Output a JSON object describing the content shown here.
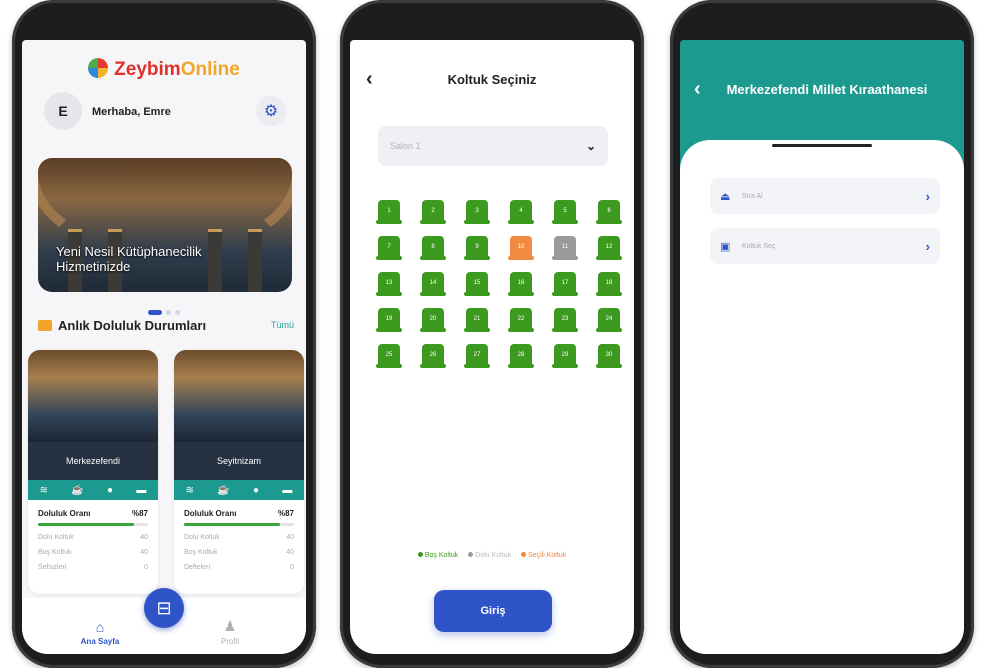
{
  "phone1": {
    "logo": {
      "part1": "Zeybim",
      "part2": "Online"
    },
    "avatar_letter": "E",
    "greeting": "Merhaba, Emre",
    "banner_text": "Yeni Nesil Kütüphanecilik Hizmetinizde",
    "section_title": "Anlık Doluluk Durumları",
    "section_link": "Tümü",
    "cards": [
      {
        "name": "Merkezefendi",
        "occupancy_label": "Doluluk Oranı",
        "occupancy": "%87",
        "occupancy_fraction": 0.87,
        "rows": [
          {
            "label": "Dolu Koltuk",
            "value": "40"
          },
          {
            "label": "Boş Koltuk",
            "value": "40"
          },
          {
            "label": "Sefsizleri",
            "value": "0"
          }
        ]
      },
      {
        "name": "Seyitnizam",
        "occupancy_label": "Doluluk Oranı",
        "occupancy": "%87",
        "occupancy_fraction": 0.87,
        "rows": [
          {
            "label": "Dolu Koltuk",
            "value": "40"
          },
          {
            "label": "Boş Koltuk",
            "value": "40"
          },
          {
            "label": "Defteleri",
            "value": "0"
          }
        ]
      }
    ],
    "tabs": {
      "home": "Ana Sayfa",
      "profile": "Profil"
    }
  },
  "phone2": {
    "title": "Koltuk Seçiniz",
    "select_placeholder": "Salon 1",
    "seats": [
      "1",
      "2",
      "3",
      "4",
      "5",
      "6",
      "7",
      "8",
      "9",
      "10",
      "11",
      "12",
      "13",
      "14",
      "15",
      "16",
      "17",
      "18",
      "19",
      "20",
      "21",
      "22",
      "23",
      "24",
      "25",
      "26",
      "27",
      "28",
      "29",
      "30"
    ],
    "selected_seat": "10",
    "full_seat": "11",
    "legend": {
      "empty": "Boş Koltuk",
      "full": "Dolu Koltuk",
      "selected": "Seçili Koltuk"
    },
    "colors": {
      "empty": "#3c9a1e",
      "full": "#9a9a9a",
      "selected": "#ef8a40"
    },
    "button": "Giriş"
  },
  "phone3": {
    "title": "Merkezefendi Millet Kıraathanesi",
    "menu": [
      {
        "label": "Sıra Al",
        "icon": "queue-icon"
      },
      {
        "label": "Koltuk Seç",
        "icon": "seat-icon"
      }
    ]
  }
}
